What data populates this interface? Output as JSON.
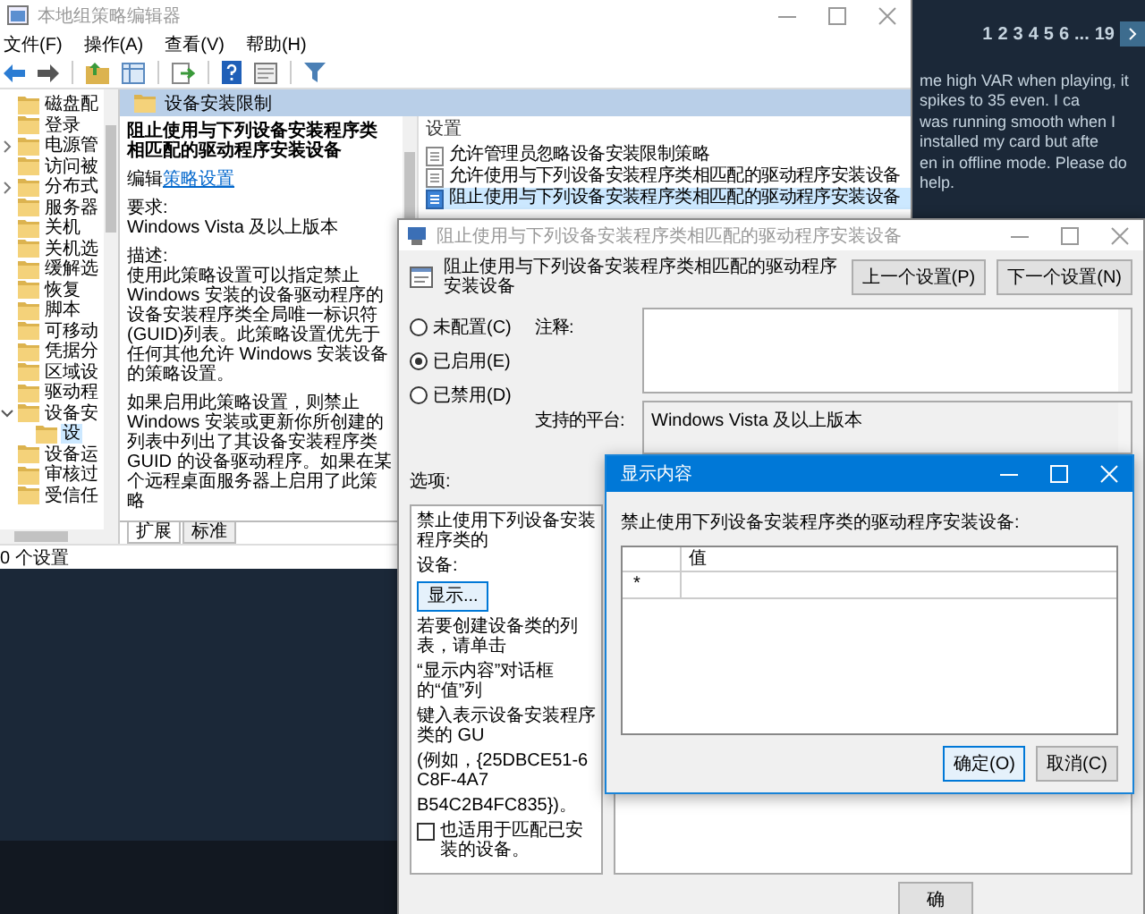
{
  "background_page": {
    "pagination": [
      "1",
      "2",
      "3",
      "4",
      "5",
      "6",
      "...",
      "19"
    ],
    "post_lines": [
      "me high VAR when playing, it spikes to 35 even. I ca",
      "was running smooth when I installed my card but afte",
      "en in offline mode. Please do help."
    ]
  },
  "policy_editor": {
    "title": "本地组策略编辑器",
    "menu": [
      "文件(F)",
      "操作(A)",
      "查看(V)",
      "帮助(H)"
    ],
    "tree": [
      {
        "label": "磁盘配",
        "selected": false
      },
      {
        "label": "登录",
        "selected": false
      },
      {
        "label": "电源管",
        "selected": false,
        "expanded": false
      },
      {
        "label": "访问被",
        "selected": false
      },
      {
        "label": "分布式",
        "selected": false,
        "expanded": false
      },
      {
        "label": "服务器",
        "selected": false
      },
      {
        "label": "关机",
        "selected": false
      },
      {
        "label": "关机选",
        "selected": false
      },
      {
        "label": "缓解选",
        "selected": false
      },
      {
        "label": "恢复",
        "selected": false
      },
      {
        "label": "脚本",
        "selected": false
      },
      {
        "label": "可移动",
        "selected": false
      },
      {
        "label": "凭据分",
        "selected": false
      },
      {
        "label": "区域设",
        "selected": false
      },
      {
        "label": "驱动程",
        "selected": false
      },
      {
        "label": "设备安",
        "selected": false,
        "expanded": true,
        "children": [
          {
            "label": "设",
            "selected": true
          }
        ]
      },
      {
        "label": "设备运",
        "selected": false
      },
      {
        "label": "审核过",
        "selected": false
      },
      {
        "label": "受信任",
        "selected": false
      }
    ],
    "header": "设备安装限制",
    "description": {
      "title": "阻止使用与下列设备安装程序类相匹配的驱动程序安装设备",
      "edit_prefix": "编辑",
      "edit_link": "策略设置",
      "requirements_label": "要求:",
      "requirements": "Windows Vista 及以上版本",
      "description_label": "描述:",
      "paragraphs": [
        "使用此策略设置可以指定禁止 Windows 安装的设备驱动程序的设备安装程序类全局唯一标识符(GUID)列表。此策略设置优先于任何其他允许 Windows 安装设备的策略设置。",
        "如果启用此策略设置，则禁止 Windows 安装或更新你所创建的列表中列出了其设备安装程序类 GUID 的设备驱动程序。如果在某个远程桌面服务器上启用了此策略"
      ]
    },
    "tabs": [
      {
        "label": "扩展",
        "selected": true
      },
      {
        "label": "标准",
        "selected": false
      }
    ],
    "settings_heading": "设置",
    "settings": [
      {
        "label": "允许管理员忽略设备安装限制策略",
        "selected": false
      },
      {
        "label": "允许使用与下列设备安装程序类相匹配的驱动程序安装设备",
        "selected": false
      },
      {
        "label": "阻止使用与下列设备安装程序类相匹配的驱动程序安装设备",
        "selected": true
      }
    ],
    "status_bar": "0 个设置"
  },
  "settings_dialog": {
    "title": "阻止使用与下列设备安装程序类相匹配的驱动程序安装设备",
    "heading": "阻止使用与下列设备安装程序类相匹配的驱动程序安装设备",
    "nav_buttons": [
      "上一个设置(P)",
      "下一个设置(N)"
    ],
    "states": [
      {
        "label": "未配置(C)",
        "selected": false
      },
      {
        "label": "已启用(E)",
        "selected": true
      },
      {
        "label": "已禁用(D)",
        "selected": false
      }
    ],
    "comment_label": "注释:",
    "platform_label": "支持的平台:",
    "platform": "Windows Vista 及以上版本",
    "options_label": "选项:",
    "options": [
      {
        "kind": "text",
        "text": "禁止使用下列设备安装程序类的"
      },
      {
        "kind": "text",
        "text": "设备:"
      },
      {
        "kind": "button",
        "text": "显示..."
      },
      {
        "kind": "text",
        "text": "若要创建设备类的列表，请单击"
      },
      {
        "kind": "text",
        "text": "“显示内容”对话框的“值”列"
      },
      {
        "kind": "text",
        "text": "键入表示设备安装程序类的 GU"
      },
      {
        "kind": "text",
        "text": "(例如，{25DBCE51-6C8F-4A7"
      },
      {
        "kind": "text",
        "text": "B54C2B4FC835})。"
      },
      {
        "kind": "checkbox",
        "text": "也适用于匹配已安装的设备。",
        "checked": false
      }
    ],
    "footer_buttons": [
      "确"
    ]
  },
  "show_contents_dialog": {
    "title": "显示内容",
    "prompt": "禁止使用下列设备安装程序类的驱动程序安装设备:",
    "columns": [
      "值"
    ],
    "rows": [
      {
        "marker": "*"
      }
    ],
    "buttons": [
      {
        "label": "确定(O)",
        "default": true
      },
      {
        "label": "取消(C)",
        "default": false
      }
    ]
  }
}
